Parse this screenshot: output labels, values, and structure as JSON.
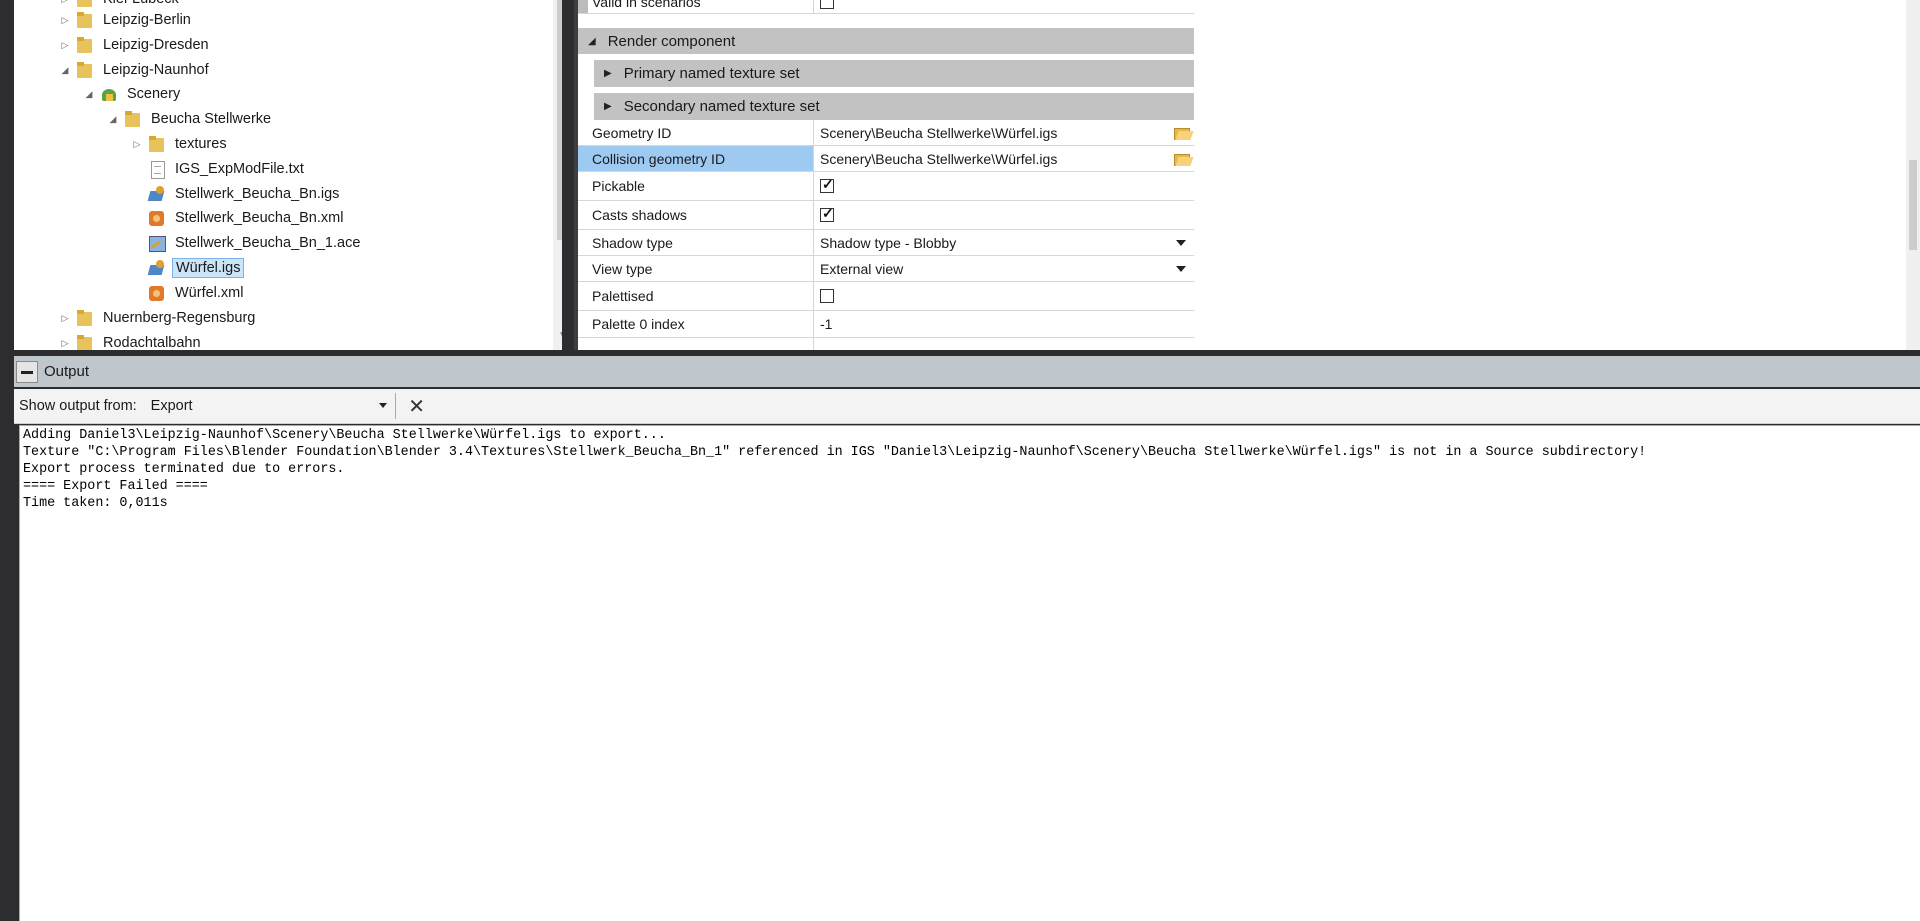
{
  "explorer": {
    "items": [
      {
        "label": "Kiel-Lübeck",
        "icon": "folder-icon",
        "expander": "collapsed",
        "selected": false
      },
      {
        "label": "Leipzig-Berlin",
        "icon": "folder-icon",
        "expander": "collapsed",
        "selected": false
      },
      {
        "label": "Leipzig-Dresden",
        "icon": "folder-icon",
        "expander": "collapsed",
        "selected": false
      },
      {
        "label": "Leipzig-Naunhof",
        "icon": "folder-icon",
        "expander": "expanded",
        "selected": false
      },
      {
        "label": "Scenery",
        "icon": "scenery-icon",
        "expander": "expanded",
        "selected": false
      },
      {
        "label": "Beucha Stellwerke",
        "icon": "folder-icon",
        "expander": "expanded",
        "selected": false
      },
      {
        "label": "textures",
        "icon": "folder-icon",
        "expander": "collapsed",
        "selected": false
      },
      {
        "label": "IGS_ExpModFile.txt",
        "icon": "text-file-icon",
        "expander": "none",
        "selected": false
      },
      {
        "label": "Stellwerk_Beucha_Bn.igs",
        "icon": "igs-file-icon",
        "expander": "none",
        "selected": false
      },
      {
        "label": "Stellwerk_Beucha_Bn.xml",
        "icon": "xml-file-icon",
        "expander": "none",
        "selected": false
      },
      {
        "label": "Stellwerk_Beucha_Bn_1.ace",
        "icon": "ace-file-icon",
        "expander": "none",
        "selected": false
      },
      {
        "label": "Würfel.igs",
        "icon": "igs-file-icon",
        "expander": "none",
        "selected": true
      },
      {
        "label": "Würfel.xml",
        "icon": "xml-file-icon",
        "expander": "none",
        "selected": false
      },
      {
        "label": "Nuernberg-Regensburg",
        "icon": "folder-icon",
        "expander": "collapsed",
        "selected": false
      },
      {
        "label": "Rodachtalbahn",
        "icon": "folder-icon",
        "expander": "collapsed",
        "selected": false
      }
    ]
  },
  "properties": {
    "valid_in_scenarios": {
      "label": "Valid in scenarios",
      "checked": false
    },
    "render_component": "Render component",
    "primary_texture_set": "Primary named texture set",
    "secondary_texture_set": "Secondary named texture set",
    "rows": {
      "geometry_id": {
        "label": "Geometry ID",
        "value": "Scenery\\Beucha Stellwerke\\Würfel.igs"
      },
      "collision_geometry_id": {
        "label": "Collision geometry ID",
        "value": "Scenery\\Beucha Stellwerke\\Würfel.igs"
      },
      "pickable": {
        "label": "Pickable",
        "checked": true
      },
      "casts_shadows": {
        "label": "Casts shadows",
        "checked": true
      },
      "shadow_type": {
        "label": "Shadow type",
        "value": "Shadow type - Blobby"
      },
      "view_type": {
        "label": "View type",
        "value": "External view"
      },
      "palettised": {
        "label": "Palettised",
        "checked": false
      },
      "palette_0_index": {
        "label": "Palette 0 index",
        "value": "-1"
      }
    }
  },
  "output": {
    "title": "Output",
    "show_from_label": "Show output from:",
    "source": "Export",
    "text": "Adding Daniel3\\Leipzig-Naunhof\\Scenery\\Beucha Stellwerke\\Würfel.igs to export...\nTexture \"C:\\Program Files\\Blender Foundation\\Blender 3.4\\Textures\\Stellwerk_Beucha_Bn_1\" referenced in IGS \"Daniel3\\Leipzig-Naunhof\\Scenery\\Beucha Stellwerke\\Würfel.igs\" is not in a Source subdirectory!\nExport process terminated due to errors.\n==== Export Failed ====\nTime taken: 0,011s"
  }
}
